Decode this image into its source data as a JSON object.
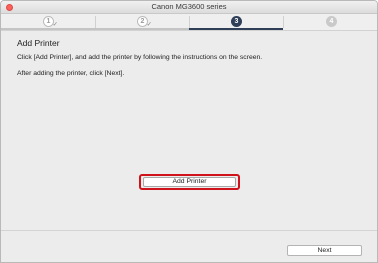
{
  "window": {
    "title": "Canon MG3600 series"
  },
  "steps": [
    {
      "number": "1",
      "state": "completed"
    },
    {
      "number": "2",
      "state": "completed"
    },
    {
      "number": "3",
      "state": "current"
    },
    {
      "number": "4",
      "state": "upcoming"
    }
  ],
  "steps_check": "✓",
  "main": {
    "title": "Add Printer",
    "instruction_1": "Click [Add Printer], and add the printer by following the instructions on the screen.",
    "instruction_2": "After adding the printer, click [Next].",
    "add_printer_label": "Add Printer"
  },
  "footer": {
    "next_label": "Next"
  },
  "colors": {
    "current_step": "#2f3f58",
    "highlight": "#d0121b",
    "close_button": "#fc605b"
  }
}
